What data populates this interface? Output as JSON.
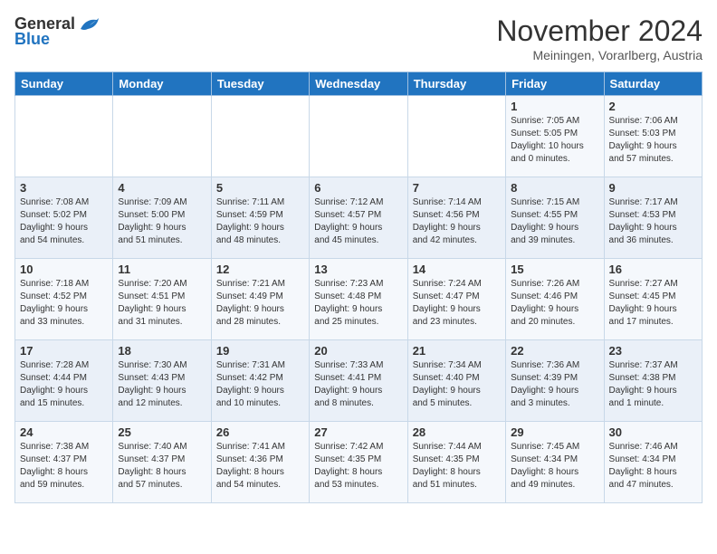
{
  "logo": {
    "general": "General",
    "blue": "Blue"
  },
  "title": "November 2024",
  "location": "Meiningen, Vorarlberg, Austria",
  "weekdays": [
    "Sunday",
    "Monday",
    "Tuesday",
    "Wednesday",
    "Thursday",
    "Friday",
    "Saturday"
  ],
  "weeks": [
    [
      {
        "day": "",
        "info": ""
      },
      {
        "day": "",
        "info": ""
      },
      {
        "day": "",
        "info": ""
      },
      {
        "day": "",
        "info": ""
      },
      {
        "day": "",
        "info": ""
      },
      {
        "day": "1",
        "info": "Sunrise: 7:05 AM\nSunset: 5:05 PM\nDaylight: 10 hours\nand 0 minutes."
      },
      {
        "day": "2",
        "info": "Sunrise: 7:06 AM\nSunset: 5:03 PM\nDaylight: 9 hours\nand 57 minutes."
      }
    ],
    [
      {
        "day": "3",
        "info": "Sunrise: 7:08 AM\nSunset: 5:02 PM\nDaylight: 9 hours\nand 54 minutes."
      },
      {
        "day": "4",
        "info": "Sunrise: 7:09 AM\nSunset: 5:00 PM\nDaylight: 9 hours\nand 51 minutes."
      },
      {
        "day": "5",
        "info": "Sunrise: 7:11 AM\nSunset: 4:59 PM\nDaylight: 9 hours\nand 48 minutes."
      },
      {
        "day": "6",
        "info": "Sunrise: 7:12 AM\nSunset: 4:57 PM\nDaylight: 9 hours\nand 45 minutes."
      },
      {
        "day": "7",
        "info": "Sunrise: 7:14 AM\nSunset: 4:56 PM\nDaylight: 9 hours\nand 42 minutes."
      },
      {
        "day": "8",
        "info": "Sunrise: 7:15 AM\nSunset: 4:55 PM\nDaylight: 9 hours\nand 39 minutes."
      },
      {
        "day": "9",
        "info": "Sunrise: 7:17 AM\nSunset: 4:53 PM\nDaylight: 9 hours\nand 36 minutes."
      }
    ],
    [
      {
        "day": "10",
        "info": "Sunrise: 7:18 AM\nSunset: 4:52 PM\nDaylight: 9 hours\nand 33 minutes."
      },
      {
        "day": "11",
        "info": "Sunrise: 7:20 AM\nSunset: 4:51 PM\nDaylight: 9 hours\nand 31 minutes."
      },
      {
        "day": "12",
        "info": "Sunrise: 7:21 AM\nSunset: 4:49 PM\nDaylight: 9 hours\nand 28 minutes."
      },
      {
        "day": "13",
        "info": "Sunrise: 7:23 AM\nSunset: 4:48 PM\nDaylight: 9 hours\nand 25 minutes."
      },
      {
        "day": "14",
        "info": "Sunrise: 7:24 AM\nSunset: 4:47 PM\nDaylight: 9 hours\nand 23 minutes."
      },
      {
        "day": "15",
        "info": "Sunrise: 7:26 AM\nSunset: 4:46 PM\nDaylight: 9 hours\nand 20 minutes."
      },
      {
        "day": "16",
        "info": "Sunrise: 7:27 AM\nSunset: 4:45 PM\nDaylight: 9 hours\nand 17 minutes."
      }
    ],
    [
      {
        "day": "17",
        "info": "Sunrise: 7:28 AM\nSunset: 4:44 PM\nDaylight: 9 hours\nand 15 minutes."
      },
      {
        "day": "18",
        "info": "Sunrise: 7:30 AM\nSunset: 4:43 PM\nDaylight: 9 hours\nand 12 minutes."
      },
      {
        "day": "19",
        "info": "Sunrise: 7:31 AM\nSunset: 4:42 PM\nDaylight: 9 hours\nand 10 minutes."
      },
      {
        "day": "20",
        "info": "Sunrise: 7:33 AM\nSunset: 4:41 PM\nDaylight: 9 hours\nand 8 minutes."
      },
      {
        "day": "21",
        "info": "Sunrise: 7:34 AM\nSunset: 4:40 PM\nDaylight: 9 hours\nand 5 minutes."
      },
      {
        "day": "22",
        "info": "Sunrise: 7:36 AM\nSunset: 4:39 PM\nDaylight: 9 hours\nand 3 minutes."
      },
      {
        "day": "23",
        "info": "Sunrise: 7:37 AM\nSunset: 4:38 PM\nDaylight: 9 hours\nand 1 minute."
      }
    ],
    [
      {
        "day": "24",
        "info": "Sunrise: 7:38 AM\nSunset: 4:37 PM\nDaylight: 8 hours\nand 59 minutes."
      },
      {
        "day": "25",
        "info": "Sunrise: 7:40 AM\nSunset: 4:37 PM\nDaylight: 8 hours\nand 57 minutes."
      },
      {
        "day": "26",
        "info": "Sunrise: 7:41 AM\nSunset: 4:36 PM\nDaylight: 8 hours\nand 54 minutes."
      },
      {
        "day": "27",
        "info": "Sunrise: 7:42 AM\nSunset: 4:35 PM\nDaylight: 8 hours\nand 53 minutes."
      },
      {
        "day": "28",
        "info": "Sunrise: 7:44 AM\nSunset: 4:35 PM\nDaylight: 8 hours\nand 51 minutes."
      },
      {
        "day": "29",
        "info": "Sunrise: 7:45 AM\nSunset: 4:34 PM\nDaylight: 8 hours\nand 49 minutes."
      },
      {
        "day": "30",
        "info": "Sunrise: 7:46 AM\nSunset: 4:34 PM\nDaylight: 8 hours\nand 47 minutes."
      }
    ]
  ]
}
